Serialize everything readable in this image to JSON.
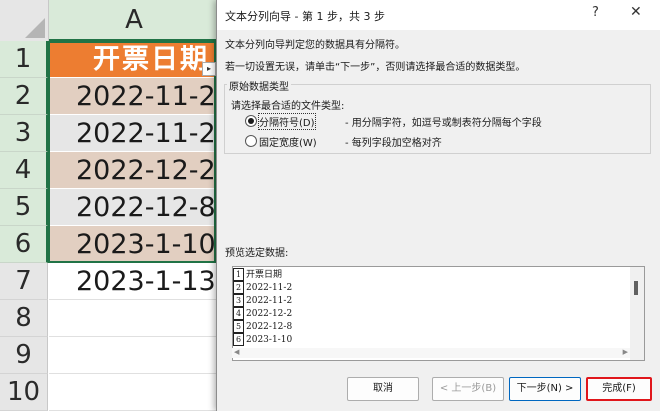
{
  "sheet": {
    "column_header": "A",
    "row_numbers": [
      "1",
      "2",
      "3",
      "4",
      "5",
      "6",
      "7",
      "8",
      "9",
      "10"
    ],
    "cells": [
      "开票日期",
      "2022-11-2",
      "2022-11-2",
      "2022-12-2",
      "2022-12-8",
      "2023-1-10",
      "2023-1-13"
    ],
    "header_fill": "#ed7d31",
    "band_colors": [
      "#e2cfc1",
      "#e6e6e6"
    ]
  },
  "dialog": {
    "title": "文本分列向导 - 第 1 步，共 3 步",
    "help_label": "?",
    "close_label": "✕",
    "description1": "文本分列向导判定您的数据具有分隔符。",
    "description2": "若一切设置无误，请单击“下一步”，否则请选择最合适的数据类型。",
    "group_label": "原始数据类型",
    "choose_label": "请选择最合适的文件类型:",
    "options": [
      {
        "label": "分隔符号(D)",
        "description": "- 用分隔字符，如逗号或制表符分隔每个字段",
        "selected": true
      },
      {
        "label": "固定宽度(W)",
        "description": "- 每列字段加空格对齐",
        "selected": false
      }
    ],
    "preview_label": "预览选定数据:",
    "preview_rows": [
      {
        "num": "1",
        "text": "开票日期"
      },
      {
        "num": "2",
        "text": "2022-11-2"
      },
      {
        "num": "3",
        "text": "2022-11-2"
      },
      {
        "num": "4",
        "text": "2022-12-2"
      },
      {
        "num": "5",
        "text": "2022-12-8"
      },
      {
        "num": "6",
        "text": "2023-1-10"
      }
    ],
    "buttons": {
      "cancel": "取消",
      "back": "< 上一步(B)",
      "next": "下一步(N) >",
      "finish": "完成(F)"
    },
    "accent_color": "#0067c0",
    "highlight_color": "#e0161b"
  }
}
